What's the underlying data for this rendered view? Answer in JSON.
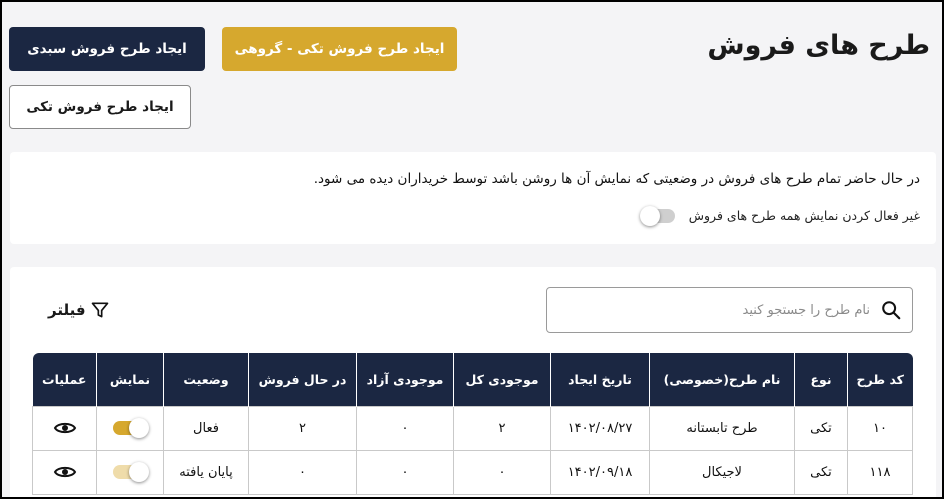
{
  "header": {
    "title": "طرح های فروش",
    "buttons": {
      "group_single": "ایجاد طرح فروش تکی - گروهی",
      "basket": "ایجاد طرح فروش سبدی",
      "single": "ایجاد طرح فروش تکی"
    }
  },
  "notice": {
    "text": "در حال حاضر تمام طرح های فروش در وضعیتی که نمایش آن ها روشن باشد توسط خریداران دیده می شود.",
    "toggle_label": "غیر فعال کردن نمایش همه طرح های فروش",
    "toggle_on": false
  },
  "search": {
    "placeholder": "نام طرح را جستجو کنید",
    "icon": "search-icon"
  },
  "filter": {
    "label": "فیلتر",
    "icon": "filter-icon"
  },
  "table": {
    "headers": [
      "کد طرح",
      "نوع",
      "نام طرح(خصوصی)",
      "تاریخ ایجاد",
      "موجودی کل",
      "موجودی آزاد",
      "در حال فروش",
      "وضعیت",
      "نمایش",
      "عملیات"
    ],
    "rows": [
      {
        "code": "۱۰",
        "type": "تکی",
        "name": "طرح تابستانه",
        "created": "۱۴۰۲/۰۸/۲۷",
        "total": "۲",
        "free": "۰",
        "selling": "۲",
        "status": "فعال",
        "display_on": true,
        "action_icon": "eye-icon"
      },
      {
        "code": "۱۱۸",
        "type": "تکی",
        "name": "لاجیکال",
        "created": "۱۴۰۲/۰۹/۱۸",
        "total": "۰",
        "free": "۰",
        "selling": "۰",
        "status": "پایان یافته",
        "display_on": true,
        "action_icon": "eye-icon"
      }
    ]
  },
  "colors": {
    "navy": "#1b2742",
    "gold": "#d6a82e",
    "background": "#f4f4f6"
  }
}
